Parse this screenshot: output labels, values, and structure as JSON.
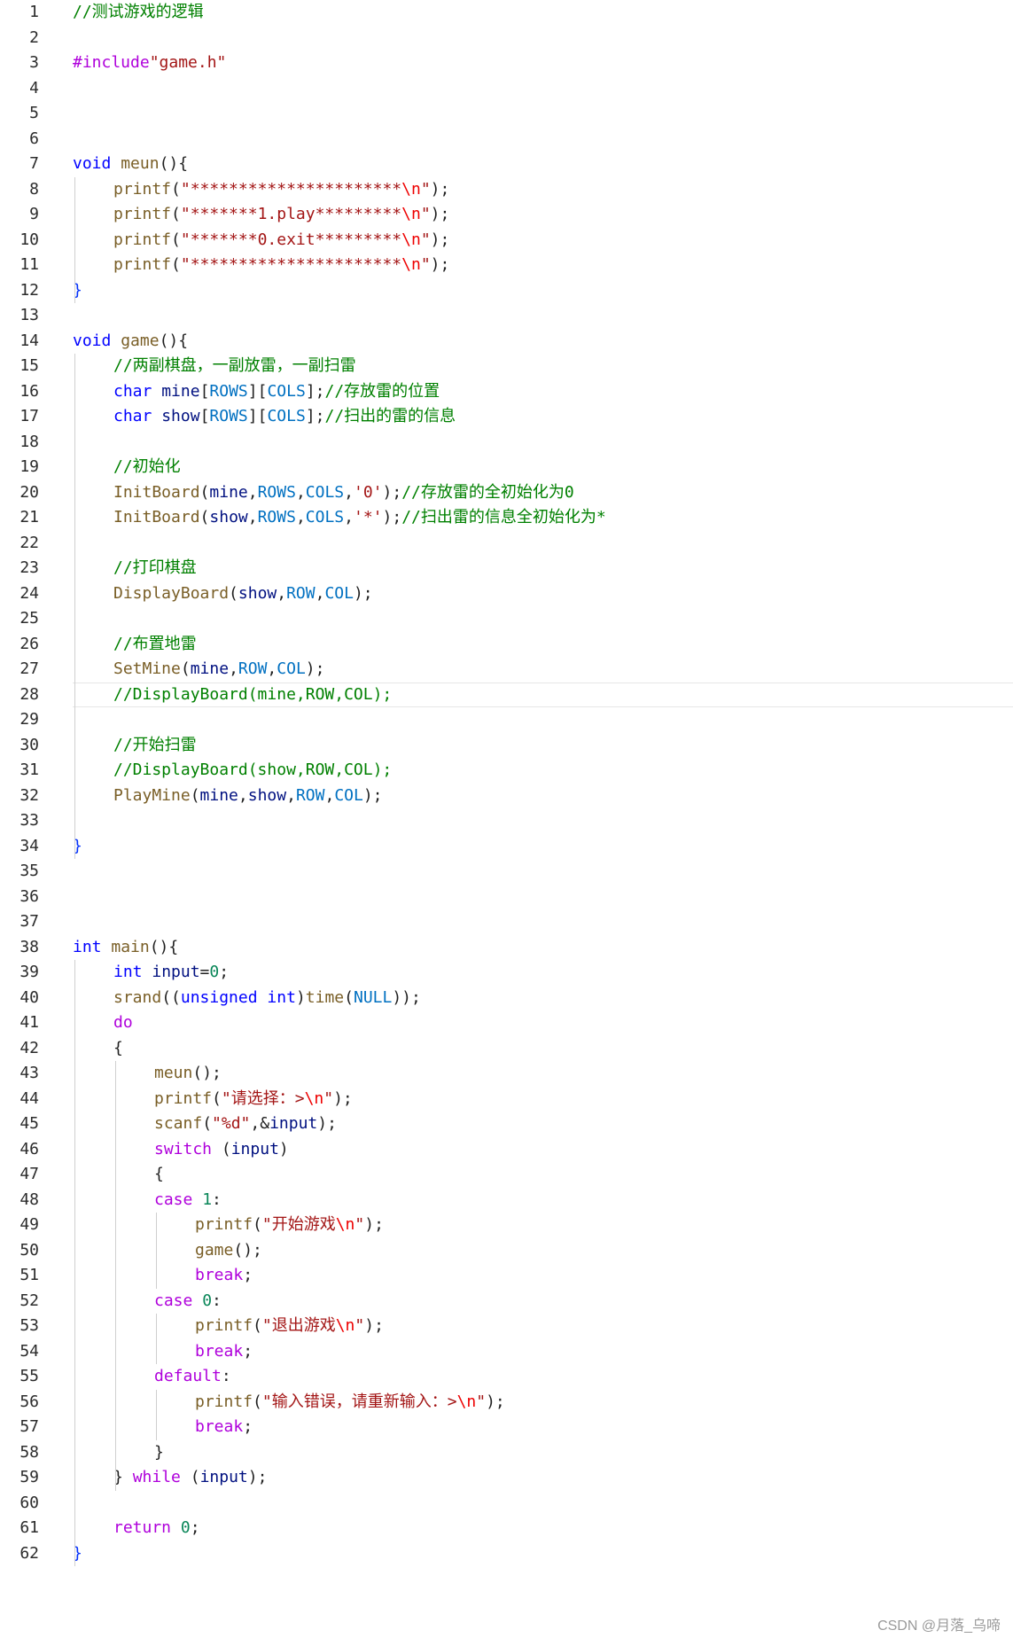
{
  "editor": {
    "current_line": 28,
    "lines": [
      {
        "n": "1",
        "indent": 0,
        "tokens": [
          {
            "t": "//测试游戏的逻辑",
            "c": "cm"
          }
        ]
      },
      {
        "n": "2",
        "indent": 0,
        "tokens": []
      },
      {
        "n": "3",
        "indent": 0,
        "tokens": [
          {
            "t": "#include",
            "c": "dir"
          },
          {
            "t": "\"game.h\"",
            "c": "str"
          }
        ]
      },
      {
        "n": "4",
        "indent": 0,
        "tokens": []
      },
      {
        "n": "5",
        "indent": 0,
        "tokens": []
      },
      {
        "n": "6",
        "indent": 0,
        "tokens": []
      },
      {
        "n": "7",
        "indent": 0,
        "tokens": [
          {
            "t": "void",
            "c": "kw"
          },
          {
            "t": " ",
            "c": "p"
          },
          {
            "t": "meun",
            "c": "fn"
          },
          {
            "t": "(){",
            "c": "p"
          }
        ]
      },
      {
        "n": "8",
        "indent": 1,
        "tokens": [
          {
            "t": "printf",
            "c": "fn"
          },
          {
            "t": "(",
            "c": "p"
          },
          {
            "t": "\"**********************",
            "c": "str"
          },
          {
            "t": "\\n",
            "c": "esc"
          },
          {
            "t": "\"",
            "c": "str"
          },
          {
            "t": ");",
            "c": "p"
          }
        ]
      },
      {
        "n": "9",
        "indent": 1,
        "tokens": [
          {
            "t": "printf",
            "c": "fn"
          },
          {
            "t": "(",
            "c": "p"
          },
          {
            "t": "\"*******1.play*********",
            "c": "str"
          },
          {
            "t": "\\n",
            "c": "esc"
          },
          {
            "t": "\"",
            "c": "str"
          },
          {
            "t": ");",
            "c": "p"
          }
        ]
      },
      {
        "n": "10",
        "indent": 1,
        "tokens": [
          {
            "t": "printf",
            "c": "fn"
          },
          {
            "t": "(",
            "c": "p"
          },
          {
            "t": "\"*******0.exit*********",
            "c": "str"
          },
          {
            "t": "\\n",
            "c": "esc"
          },
          {
            "t": "\"",
            "c": "str"
          },
          {
            "t": ");",
            "c": "p"
          }
        ]
      },
      {
        "n": "11",
        "indent": 1,
        "tokens": [
          {
            "t": "printf",
            "c": "fn"
          },
          {
            "t": "(",
            "c": "p"
          },
          {
            "t": "\"**********************",
            "c": "str"
          },
          {
            "t": "\\n",
            "c": "esc"
          },
          {
            "t": "\"",
            "c": "str"
          },
          {
            "t": ");",
            "c": "p"
          }
        ]
      },
      {
        "n": "12",
        "indent": 0,
        "tokens": [
          {
            "t": "}",
            "c": "brace"
          }
        ]
      },
      {
        "n": "13",
        "indent": 0,
        "tokens": []
      },
      {
        "n": "14",
        "indent": 0,
        "tokens": [
          {
            "t": "void",
            "c": "kw"
          },
          {
            "t": " ",
            "c": "p"
          },
          {
            "t": "game",
            "c": "fn"
          },
          {
            "t": "(){",
            "c": "p"
          }
        ]
      },
      {
        "n": "15",
        "indent": 1,
        "tokens": [
          {
            "t": "//两副棋盘，一副放雷，一副扫雷",
            "c": "cm"
          }
        ]
      },
      {
        "n": "16",
        "indent": 1,
        "tokens": [
          {
            "t": "char",
            "c": "kw"
          },
          {
            "t": " ",
            "c": "p"
          },
          {
            "t": "mine",
            "c": "var"
          },
          {
            "t": "[",
            "c": "p"
          },
          {
            "t": "ROWS",
            "c": "mac"
          },
          {
            "t": "][",
            "c": "p"
          },
          {
            "t": "COLS",
            "c": "mac"
          },
          {
            "t": "];",
            "c": "p"
          },
          {
            "t": "//存放雷的位置",
            "c": "cm"
          }
        ]
      },
      {
        "n": "17",
        "indent": 1,
        "tokens": [
          {
            "t": "char",
            "c": "kw"
          },
          {
            "t": " ",
            "c": "p"
          },
          {
            "t": "show",
            "c": "var"
          },
          {
            "t": "[",
            "c": "p"
          },
          {
            "t": "ROWS",
            "c": "mac"
          },
          {
            "t": "][",
            "c": "p"
          },
          {
            "t": "COLS",
            "c": "mac"
          },
          {
            "t": "];",
            "c": "p"
          },
          {
            "t": "//扫出的雷的信息",
            "c": "cm"
          }
        ]
      },
      {
        "n": "18",
        "indent": 1,
        "tokens": []
      },
      {
        "n": "19",
        "indent": 1,
        "tokens": [
          {
            "t": "//初始化",
            "c": "cm"
          }
        ]
      },
      {
        "n": "20",
        "indent": 1,
        "tokens": [
          {
            "t": "InitBoard",
            "c": "fn"
          },
          {
            "t": "(",
            "c": "p"
          },
          {
            "t": "mine",
            "c": "var"
          },
          {
            "t": ",",
            "c": "p"
          },
          {
            "t": "ROWS",
            "c": "mac"
          },
          {
            "t": ",",
            "c": "p"
          },
          {
            "t": "COLS",
            "c": "mac"
          },
          {
            "t": ",",
            "c": "p"
          },
          {
            "t": "'0'",
            "c": "str"
          },
          {
            "t": ");",
            "c": "p"
          },
          {
            "t": "//存放雷的全初始化为0",
            "c": "cm"
          }
        ]
      },
      {
        "n": "21",
        "indent": 1,
        "tokens": [
          {
            "t": "InitBoard",
            "c": "fn"
          },
          {
            "t": "(",
            "c": "p"
          },
          {
            "t": "show",
            "c": "var"
          },
          {
            "t": ",",
            "c": "p"
          },
          {
            "t": "ROWS",
            "c": "mac"
          },
          {
            "t": ",",
            "c": "p"
          },
          {
            "t": "COLS",
            "c": "mac"
          },
          {
            "t": ",",
            "c": "p"
          },
          {
            "t": "'*'",
            "c": "str"
          },
          {
            "t": ");",
            "c": "p"
          },
          {
            "t": "//扫出雷的信息全初始化为*",
            "c": "cm"
          }
        ]
      },
      {
        "n": "22",
        "indent": 1,
        "tokens": []
      },
      {
        "n": "23",
        "indent": 1,
        "tokens": [
          {
            "t": "//打印棋盘",
            "c": "cm"
          }
        ]
      },
      {
        "n": "24",
        "indent": 1,
        "tokens": [
          {
            "t": "DisplayBoard",
            "c": "fn"
          },
          {
            "t": "(",
            "c": "p"
          },
          {
            "t": "show",
            "c": "var"
          },
          {
            "t": ",",
            "c": "p"
          },
          {
            "t": "ROW",
            "c": "mac"
          },
          {
            "t": ",",
            "c": "p"
          },
          {
            "t": "COL",
            "c": "mac"
          },
          {
            "t": ");",
            "c": "p"
          }
        ]
      },
      {
        "n": "25",
        "indent": 1,
        "tokens": []
      },
      {
        "n": "26",
        "indent": 1,
        "tokens": [
          {
            "t": "//布置地雷",
            "c": "cm"
          }
        ]
      },
      {
        "n": "27",
        "indent": 1,
        "tokens": [
          {
            "t": "SetMine",
            "c": "fn"
          },
          {
            "t": "(",
            "c": "p"
          },
          {
            "t": "mine",
            "c": "var"
          },
          {
            "t": ",",
            "c": "p"
          },
          {
            "t": "ROW",
            "c": "mac"
          },
          {
            "t": ",",
            "c": "p"
          },
          {
            "t": "COL",
            "c": "mac"
          },
          {
            "t": ");",
            "c": "p"
          }
        ]
      },
      {
        "n": "28",
        "indent": 1,
        "tokens": [
          {
            "t": "//DisplayBoard(mine,ROW,COL);",
            "c": "cm"
          }
        ]
      },
      {
        "n": "29",
        "indent": 1,
        "tokens": []
      },
      {
        "n": "30",
        "indent": 1,
        "tokens": [
          {
            "t": "//开始扫雷",
            "c": "cm"
          }
        ]
      },
      {
        "n": "31",
        "indent": 1,
        "tokens": [
          {
            "t": "//DisplayBoard(show,ROW,COL);",
            "c": "cm"
          }
        ]
      },
      {
        "n": "32",
        "indent": 1,
        "tokens": [
          {
            "t": "PlayMine",
            "c": "fn"
          },
          {
            "t": "(",
            "c": "p"
          },
          {
            "t": "mine",
            "c": "var"
          },
          {
            "t": ",",
            "c": "p"
          },
          {
            "t": "show",
            "c": "var"
          },
          {
            "t": ",",
            "c": "p"
          },
          {
            "t": "ROW",
            "c": "mac"
          },
          {
            "t": ",",
            "c": "p"
          },
          {
            "t": "COL",
            "c": "mac"
          },
          {
            "t": ");",
            "c": "p"
          }
        ]
      },
      {
        "n": "33",
        "indent": 1,
        "tokens": []
      },
      {
        "n": "34",
        "indent": 0,
        "tokens": [
          {
            "t": "}",
            "c": "brace"
          }
        ]
      },
      {
        "n": "35",
        "indent": 0,
        "tokens": []
      },
      {
        "n": "36",
        "indent": 0,
        "tokens": []
      },
      {
        "n": "37",
        "indent": 0,
        "tokens": []
      },
      {
        "n": "38",
        "indent": 0,
        "tokens": [
          {
            "t": "int",
            "c": "kw"
          },
          {
            "t": " ",
            "c": "p"
          },
          {
            "t": "main",
            "c": "fn"
          },
          {
            "t": "(){",
            "c": "p"
          }
        ]
      },
      {
        "n": "39",
        "indent": 1,
        "tokens": [
          {
            "t": "int",
            "c": "kw"
          },
          {
            "t": " ",
            "c": "p"
          },
          {
            "t": "input",
            "c": "var"
          },
          {
            "t": "=",
            "c": "p"
          },
          {
            "t": "0",
            "c": "num"
          },
          {
            "t": ";",
            "c": "p"
          }
        ]
      },
      {
        "n": "40",
        "indent": 1,
        "tokens": [
          {
            "t": "srand",
            "c": "fn"
          },
          {
            "t": "((",
            "c": "p"
          },
          {
            "t": "unsigned",
            "c": "kw"
          },
          {
            "t": " ",
            "c": "p"
          },
          {
            "t": "int",
            "c": "kw"
          },
          {
            "t": ")",
            "c": "p"
          },
          {
            "t": "time",
            "c": "fn"
          },
          {
            "t": "(",
            "c": "p"
          },
          {
            "t": "NULL",
            "c": "mac"
          },
          {
            "t": "));",
            "c": "p"
          }
        ]
      },
      {
        "n": "41",
        "indent": 1,
        "tokens": [
          {
            "t": "do",
            "c": "ctl"
          }
        ]
      },
      {
        "n": "42",
        "indent": 1,
        "tokens": [
          {
            "t": "{",
            "c": "p"
          }
        ]
      },
      {
        "n": "43",
        "indent": 2,
        "tokens": [
          {
            "t": "meun",
            "c": "fn"
          },
          {
            "t": "();",
            "c": "p"
          }
        ]
      },
      {
        "n": "44",
        "indent": 2,
        "tokens": [
          {
            "t": "printf",
            "c": "fn"
          },
          {
            "t": "(",
            "c": "p"
          },
          {
            "t": "\"请选择：>",
            "c": "str"
          },
          {
            "t": "\\n",
            "c": "esc"
          },
          {
            "t": "\"",
            "c": "str"
          },
          {
            "t": ");",
            "c": "p"
          }
        ]
      },
      {
        "n": "45",
        "indent": 2,
        "tokens": [
          {
            "t": "scanf",
            "c": "fn"
          },
          {
            "t": "(",
            "c": "p"
          },
          {
            "t": "\"%d\"",
            "c": "str"
          },
          {
            "t": ",&",
            "c": "p"
          },
          {
            "t": "input",
            "c": "var"
          },
          {
            "t": ");",
            "c": "p"
          }
        ]
      },
      {
        "n": "46",
        "indent": 2,
        "tokens": [
          {
            "t": "switch",
            "c": "ctl"
          },
          {
            "t": " (",
            "c": "p"
          },
          {
            "t": "input",
            "c": "var"
          },
          {
            "t": ")",
            "c": "p"
          }
        ]
      },
      {
        "n": "47",
        "indent": 2,
        "tokens": [
          {
            "t": "{",
            "c": "p"
          }
        ]
      },
      {
        "n": "48",
        "indent": 2,
        "tokens": [
          {
            "t": "case",
            "c": "ctl"
          },
          {
            "t": " ",
            "c": "p"
          },
          {
            "t": "1",
            "c": "num"
          },
          {
            "t": ":",
            "c": "p"
          }
        ]
      },
      {
        "n": "49",
        "indent": 3,
        "tokens": [
          {
            "t": "printf",
            "c": "fn"
          },
          {
            "t": "(",
            "c": "p"
          },
          {
            "t": "\"开始游戏",
            "c": "str"
          },
          {
            "t": "\\n",
            "c": "esc"
          },
          {
            "t": "\"",
            "c": "str"
          },
          {
            "t": ");",
            "c": "p"
          }
        ]
      },
      {
        "n": "50",
        "indent": 3,
        "tokens": [
          {
            "t": "game",
            "c": "fn"
          },
          {
            "t": "();",
            "c": "p"
          }
        ]
      },
      {
        "n": "51",
        "indent": 3,
        "tokens": [
          {
            "t": "break",
            "c": "ctl"
          },
          {
            "t": ";",
            "c": "p"
          }
        ]
      },
      {
        "n": "52",
        "indent": 2,
        "tokens": [
          {
            "t": "case",
            "c": "ctl"
          },
          {
            "t": " ",
            "c": "p"
          },
          {
            "t": "0",
            "c": "num"
          },
          {
            "t": ":",
            "c": "p"
          }
        ]
      },
      {
        "n": "53",
        "indent": 3,
        "tokens": [
          {
            "t": "printf",
            "c": "fn"
          },
          {
            "t": "(",
            "c": "p"
          },
          {
            "t": "\"退出游戏",
            "c": "str"
          },
          {
            "t": "\\n",
            "c": "esc"
          },
          {
            "t": "\"",
            "c": "str"
          },
          {
            "t": ");",
            "c": "p"
          }
        ]
      },
      {
        "n": "54",
        "indent": 3,
        "tokens": [
          {
            "t": "break",
            "c": "ctl"
          },
          {
            "t": ";",
            "c": "p"
          }
        ]
      },
      {
        "n": "55",
        "indent": 2,
        "tokens": [
          {
            "t": "default",
            "c": "ctl"
          },
          {
            "t": ":",
            "c": "p"
          }
        ]
      },
      {
        "n": "56",
        "indent": 3,
        "tokens": [
          {
            "t": "printf",
            "c": "fn"
          },
          {
            "t": "(",
            "c": "p"
          },
          {
            "t": "\"输入错误，请重新输入：>",
            "c": "str"
          },
          {
            "t": "\\n",
            "c": "esc"
          },
          {
            "t": "\"",
            "c": "str"
          },
          {
            "t": ");",
            "c": "p"
          }
        ]
      },
      {
        "n": "57",
        "indent": 3,
        "tokens": [
          {
            "t": "break",
            "c": "ctl"
          },
          {
            "t": ";",
            "c": "p"
          }
        ]
      },
      {
        "n": "58",
        "indent": 2,
        "tokens": [
          {
            "t": "}",
            "c": "p"
          }
        ]
      },
      {
        "n": "59",
        "indent": 1,
        "tokens": [
          {
            "t": "}",
            "c": "p"
          },
          {
            "t": " ",
            "c": "p"
          },
          {
            "t": "while",
            "c": "ctl"
          },
          {
            "t": " (",
            "c": "p"
          },
          {
            "t": "input",
            "c": "var"
          },
          {
            "t": ");",
            "c": "p"
          }
        ]
      },
      {
        "n": "60",
        "indent": 1,
        "tokens": []
      },
      {
        "n": "61",
        "indent": 1,
        "tokens": [
          {
            "t": "return",
            "c": "ctl"
          },
          {
            "t": " ",
            "c": "p"
          },
          {
            "t": "0",
            "c": "num"
          },
          {
            "t": ";",
            "c": "p"
          }
        ]
      },
      {
        "n": "62",
        "indent": 0,
        "tokens": [
          {
            "t": "}",
            "c": "brace"
          }
        ]
      }
    ]
  },
  "watermark": "CSDN @月落_乌啼"
}
